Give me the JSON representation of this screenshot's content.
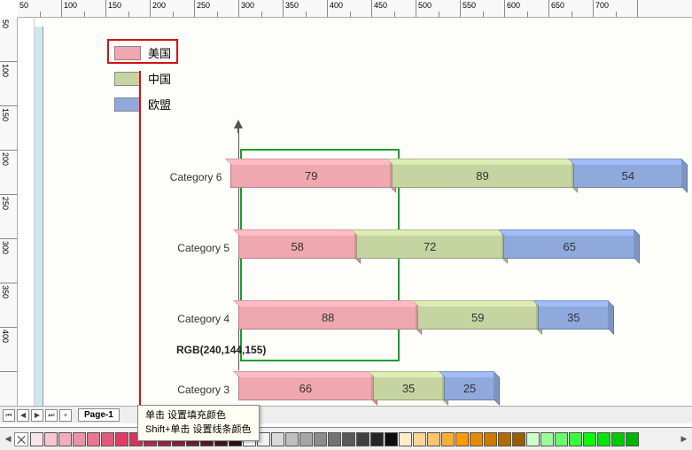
{
  "app": {
    "page_label": "Page-1",
    "rgb_readout": "RGB(240,144,155)"
  },
  "tooltip": {
    "line1": "单击 设置填充颜色",
    "line2": "Shift+单击 设置线条颜色"
  },
  "legend": [
    {
      "label": "美国",
      "color": "#f0a8b0",
      "highlighted": true
    },
    {
      "label": "中国",
      "color": "#c5d4a1",
      "highlighted": false
    },
    {
      "label": "欧盟",
      "color": "#8fa9dd",
      "highlighted": false
    }
  ],
  "ruler_h": [
    "50",
    "100",
    "150",
    "200",
    "250",
    "300",
    "350",
    "400",
    "450",
    "500",
    "550",
    "600",
    "650",
    "700"
  ],
  "ruler_v": [
    "50",
    "100",
    "150",
    "200",
    "250",
    "300",
    "350",
    "400"
  ],
  "nav_glyphs": [
    "⏮",
    "◀",
    "▶",
    "⏭",
    "+"
  ],
  "chart_data": {
    "type": "bar",
    "orientation": "horizontal-stacked",
    "title": "",
    "xlabel": "",
    "ylabel": "",
    "categories": [
      "Category 6",
      "Category 5",
      "Category 4",
      "Category 3"
    ],
    "series": [
      {
        "name": "美国",
        "color": "#f0a8b0",
        "values": [
          79,
          58,
          88,
          66
        ]
      },
      {
        "name": "中国",
        "color": "#c5d4a1",
        "values": [
          89,
          72,
          59,
          35
        ]
      },
      {
        "name": "欧盟",
        "color": "#8fa9dd",
        "values": [
          54,
          65,
          35,
          25
        ]
      }
    ]
  },
  "palette_colors": [
    "#fce3e9",
    "#f8c7d3",
    "#f4abbd",
    "#f08fa7",
    "#ec7391",
    "#e8577b",
    "#e43b65",
    "#d7335c",
    "#bf2e52",
    "#a72948",
    "#8f243e",
    "#771f34",
    "#5f1a2a",
    "#471520",
    "#2f1016",
    "#ffffff",
    "#f2f2f2",
    "#d9d9d9",
    "#bfbfbf",
    "#a6a6a6",
    "#8c8c8c",
    "#737373",
    "#595959",
    "#404040",
    "#262626",
    "#0d0d0d",
    "#ffebcc",
    "#ffd699",
    "#ffc266",
    "#ffad33",
    "#ff9900",
    "#e68a00",
    "#cc7a00",
    "#b36b00",
    "#995c00",
    "#ccffcc",
    "#99ff99",
    "#66ff66",
    "#33ff33",
    "#00ff00",
    "#00e600",
    "#00cc00",
    "#00b300"
  ]
}
